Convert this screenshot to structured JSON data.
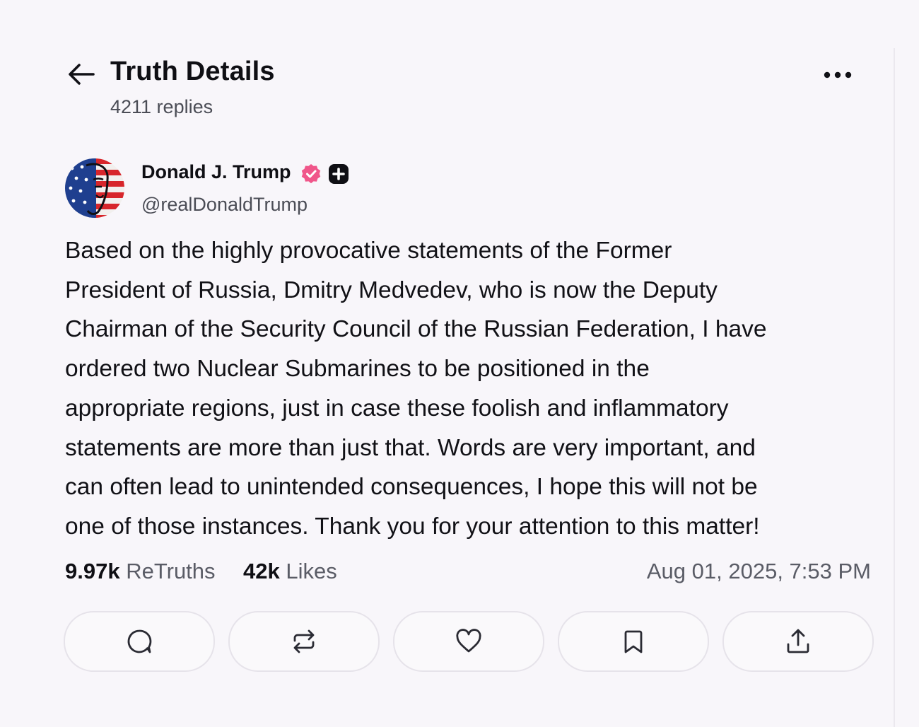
{
  "header": {
    "title": "Truth Details",
    "reply_count": "4211 replies",
    "back_icon": "arrow-left-icon",
    "more_icon": "ellipsis-icon"
  },
  "author": {
    "display_name": "Donald J. Trump",
    "handle": "@realDonaldTrump",
    "verified_icon": "verified-badge-icon",
    "verified_color": "#f0568a",
    "plus_icon": "truth-plus-badge-icon"
  },
  "post": {
    "text_lines": [
      "Based on the highly provocative statements of the Former",
      "President of Russia, Dmitry Medvedev, who is now the Deputy",
      "Chairman of the Security Council of the Russian Federation, I have",
      "ordered two Nuclear Submarines to be positioned in the",
      "appropriate regions, just in case these foolish and inflammatory",
      "statements are more than just that. Words are very important, and",
      "can often lead to unintended consequences, I hope this will not be",
      "one of those instances. Thank you for your attention to this matter!"
    ]
  },
  "stats": {
    "retruths_count": "9.97k",
    "retruths_label": "ReTruths",
    "likes_count": "42k",
    "likes_label": "Likes",
    "timestamp": "Aug 01, 2025, 7:53 PM"
  },
  "actions": [
    {
      "name": "reply",
      "icon": "comment-icon"
    },
    {
      "name": "retruth",
      "icon": "repost-icon"
    },
    {
      "name": "like",
      "icon": "heart-icon"
    },
    {
      "name": "bookmark",
      "icon": "bookmark-icon"
    },
    {
      "name": "share",
      "icon": "share-icon"
    }
  ]
}
